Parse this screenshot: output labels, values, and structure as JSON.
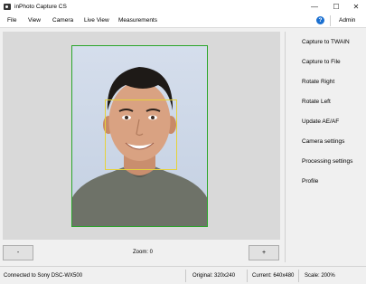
{
  "window": {
    "title": "inPhoto Capture CS",
    "minimize_glyph": "—",
    "maximize_glyph": "☐",
    "close_glyph": "✕"
  },
  "menu": {
    "items": [
      "File",
      "View",
      "Camera",
      "Live View",
      "Measurements"
    ],
    "help_glyph": "?",
    "admin_label": "Admin"
  },
  "preview": {
    "zoom_label": "Zoom: 0",
    "minus_label": "-",
    "plus_label": "+"
  },
  "sidebar": {
    "items": [
      "Capture to TWAIN",
      "Capture to File",
      "Rotate Right",
      "Rotate Left",
      "Update AE/AF",
      "Camera settings",
      "Processing settings",
      "Profile"
    ]
  },
  "status": {
    "connection": "Connected to Sony DSC-WX500",
    "original": "Original: 320x240",
    "current": "Current: 640x480",
    "scale": "Scale: 200%"
  },
  "colors": {
    "face_frame": "#2aa52a",
    "focus_frame": "#e6d23a",
    "help_icon": "#1a6fd0"
  }
}
